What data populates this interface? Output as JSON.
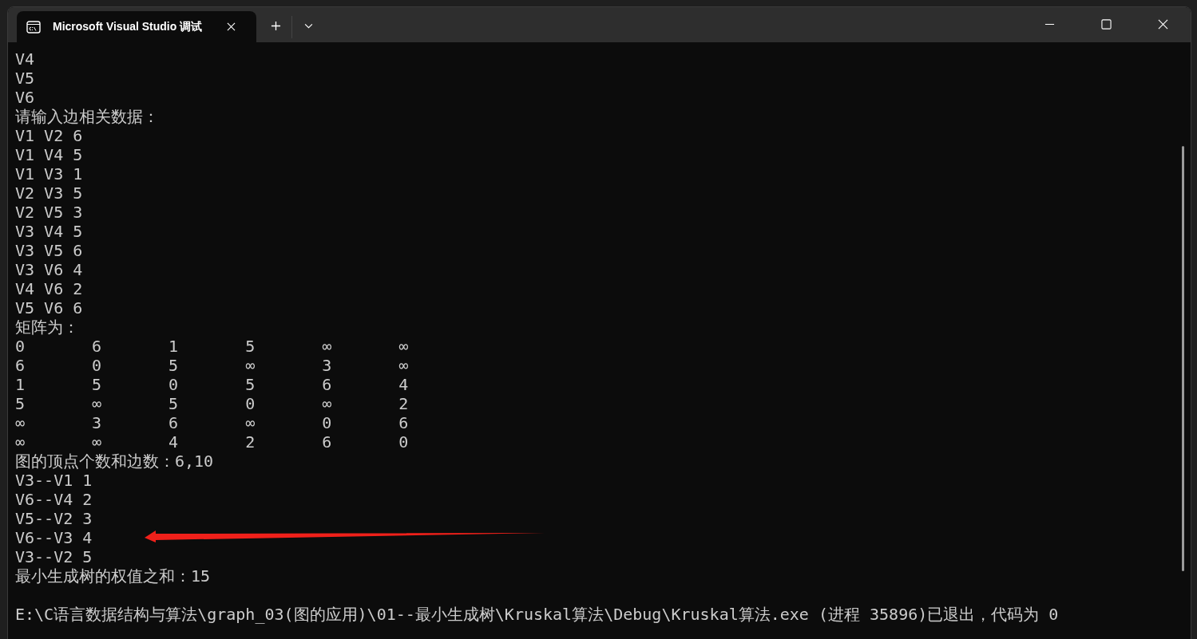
{
  "window": {
    "tab_title": "Microsoft Visual Studio 调试"
  },
  "console": {
    "lines_before": [
      "V4",
      "V5",
      "V6",
      "请输入边相关数据：",
      "V1 V2 6",
      "V1 V4 5",
      "V1 V3 1",
      "V2 V3 5",
      "V2 V5 3",
      "V3 V4 5",
      "V3 V5 6",
      "V3 V6 4",
      "V4 V6 2",
      "V5 V6 6",
      "矩阵为："
    ],
    "matrix": [
      [
        "0",
        "6",
        "1",
        "5",
        "∞",
        "∞"
      ],
      [
        "6",
        "0",
        "5",
        "∞",
        "3",
        "∞"
      ],
      [
        "1",
        "5",
        "0",
        "5",
        "6",
        "4"
      ],
      [
        "5",
        "∞",
        "5",
        "0",
        "∞",
        "2"
      ],
      [
        "∞",
        "3",
        "6",
        "∞",
        "0",
        "6"
      ],
      [
        "∞",
        "∞",
        "4",
        "2",
        "6",
        "0"
      ]
    ],
    "lines_after": [
      "图的顶点个数和边数：6,10",
      "V3--V1 1",
      "V6--V4 2",
      "V5--V2 3",
      "V6--V3 4",
      "V3--V2 5",
      "最小生成树的权值之和：15"
    ],
    "exit_message": "E:\\C语言数据结构与算法\\graph_03(图的应用)\\01--最小生成树\\Kruskal算法\\Debug\\Kruskal算法.exe (进程 35896)已退出，代码为 0"
  }
}
